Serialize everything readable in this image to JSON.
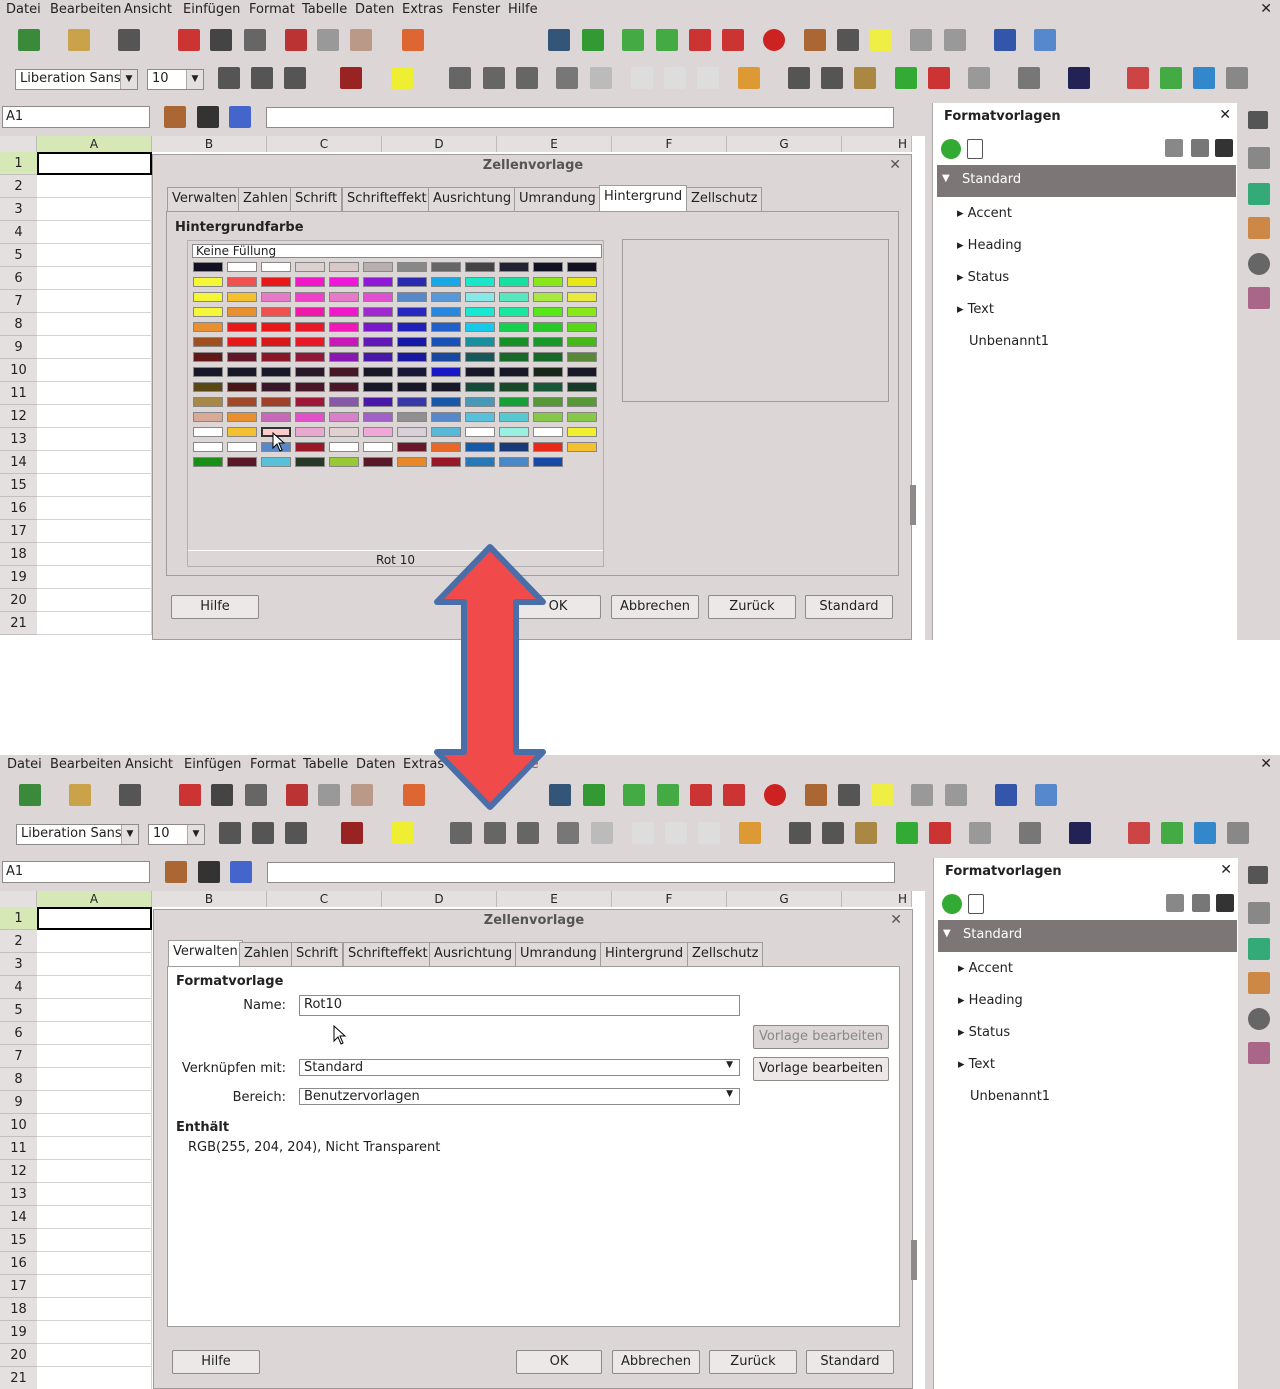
{
  "menu": [
    "Datei",
    "Bearbeiten",
    "Ansicht",
    "Einfügen",
    "Format",
    "Tabelle",
    "Daten",
    "Extras",
    "Fenster",
    "Hilfe"
  ],
  "font": {
    "name": "Liberation Sans",
    "size": "10"
  },
  "namebox": "A1",
  "columns": [
    "A",
    "B",
    "C",
    "D",
    "E",
    "F",
    "G",
    "H"
  ],
  "rows": [
    "1",
    "2",
    "3",
    "4",
    "5",
    "6",
    "7",
    "8",
    "9",
    "10",
    "11",
    "12",
    "13",
    "14",
    "15",
    "16",
    "17",
    "18",
    "19",
    "20",
    "21"
  ],
  "sidebar": {
    "title": "Formatvorlagen",
    "selected": "Standard",
    "items": [
      "Accent",
      "Heading",
      "Status",
      "Text",
      "Unbenannt1"
    ]
  },
  "dialog": {
    "title": "Zellenvorlage",
    "tabs": [
      "Verwalten",
      "Zahlen",
      "Schrift",
      "Schrifteffekt",
      "Ausrichtung",
      "Umrandung",
      "Hintergrund",
      "Zellschutz"
    ],
    "buttons": {
      "help": "Hilfe",
      "ok": "OK",
      "cancel": "Abbrechen",
      "back": "Zurück",
      "standard": "Standard"
    }
  },
  "background_tab": {
    "heading": "Hintergrundfarbe",
    "no_fill": "Keine Füllung",
    "selected_color_name": "Rot 10"
  },
  "manage_tab": {
    "heading": "Formatvorlage",
    "name_label": "Name:",
    "name_value": "Rot10",
    "link_label": "Verknüpfen mit:",
    "link_value": "Standard",
    "area_label": "Bereich:",
    "area_value": "Benutzervorlagen",
    "edit_button": "Vorlage bearbeiten",
    "contains_heading": "Enthält",
    "contains_value": "RGB(255, 204, 204), Nicht Transparent"
  },
  "colors": {
    "accent": "#e8f2a1",
    "selected_swatch": "#ffcccc"
  }
}
